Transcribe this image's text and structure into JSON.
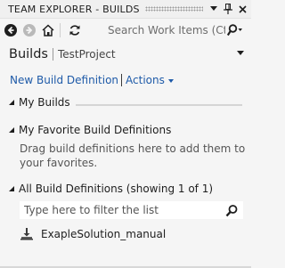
{
  "titlebar": {
    "title": "TEAM EXPLORER - BUILDS",
    "pin_icon": "pin-icon",
    "close_icon": "close-icon",
    "dropdown_icon": "dropdown-arrow-icon"
  },
  "toolbar": {
    "back_icon": "back-arrow-icon",
    "forward_icon": "forward-arrow-icon",
    "home_icon": "home-icon",
    "refresh_icon": "refresh-icon",
    "search_placeholder": "Search Work Items (Ctrl",
    "search_icon": "search-icon"
  },
  "header": {
    "title": "Builds",
    "project": "TestProject"
  },
  "actions": {
    "new_build_definition": "New Build Definition",
    "actions_label": "Actions"
  },
  "sections": {
    "my_builds": {
      "title": "My Builds"
    },
    "favorites": {
      "title": "My Favorite Build Definitions",
      "body": "Drag build definitions here to add them to your favorites."
    },
    "all_definitions": {
      "title": "All Build Definitions (showing 1 of 1)",
      "filter_placeholder": "Type here to filter the list",
      "items": [
        {
          "label": "ExapleSolution_manual",
          "icon": "build-definition-icon"
        }
      ]
    }
  },
  "colors": {
    "background": "#f5f5f5",
    "link": "#1e5aa8",
    "text": "#1e1e1e",
    "muted_text": "#555555"
  }
}
